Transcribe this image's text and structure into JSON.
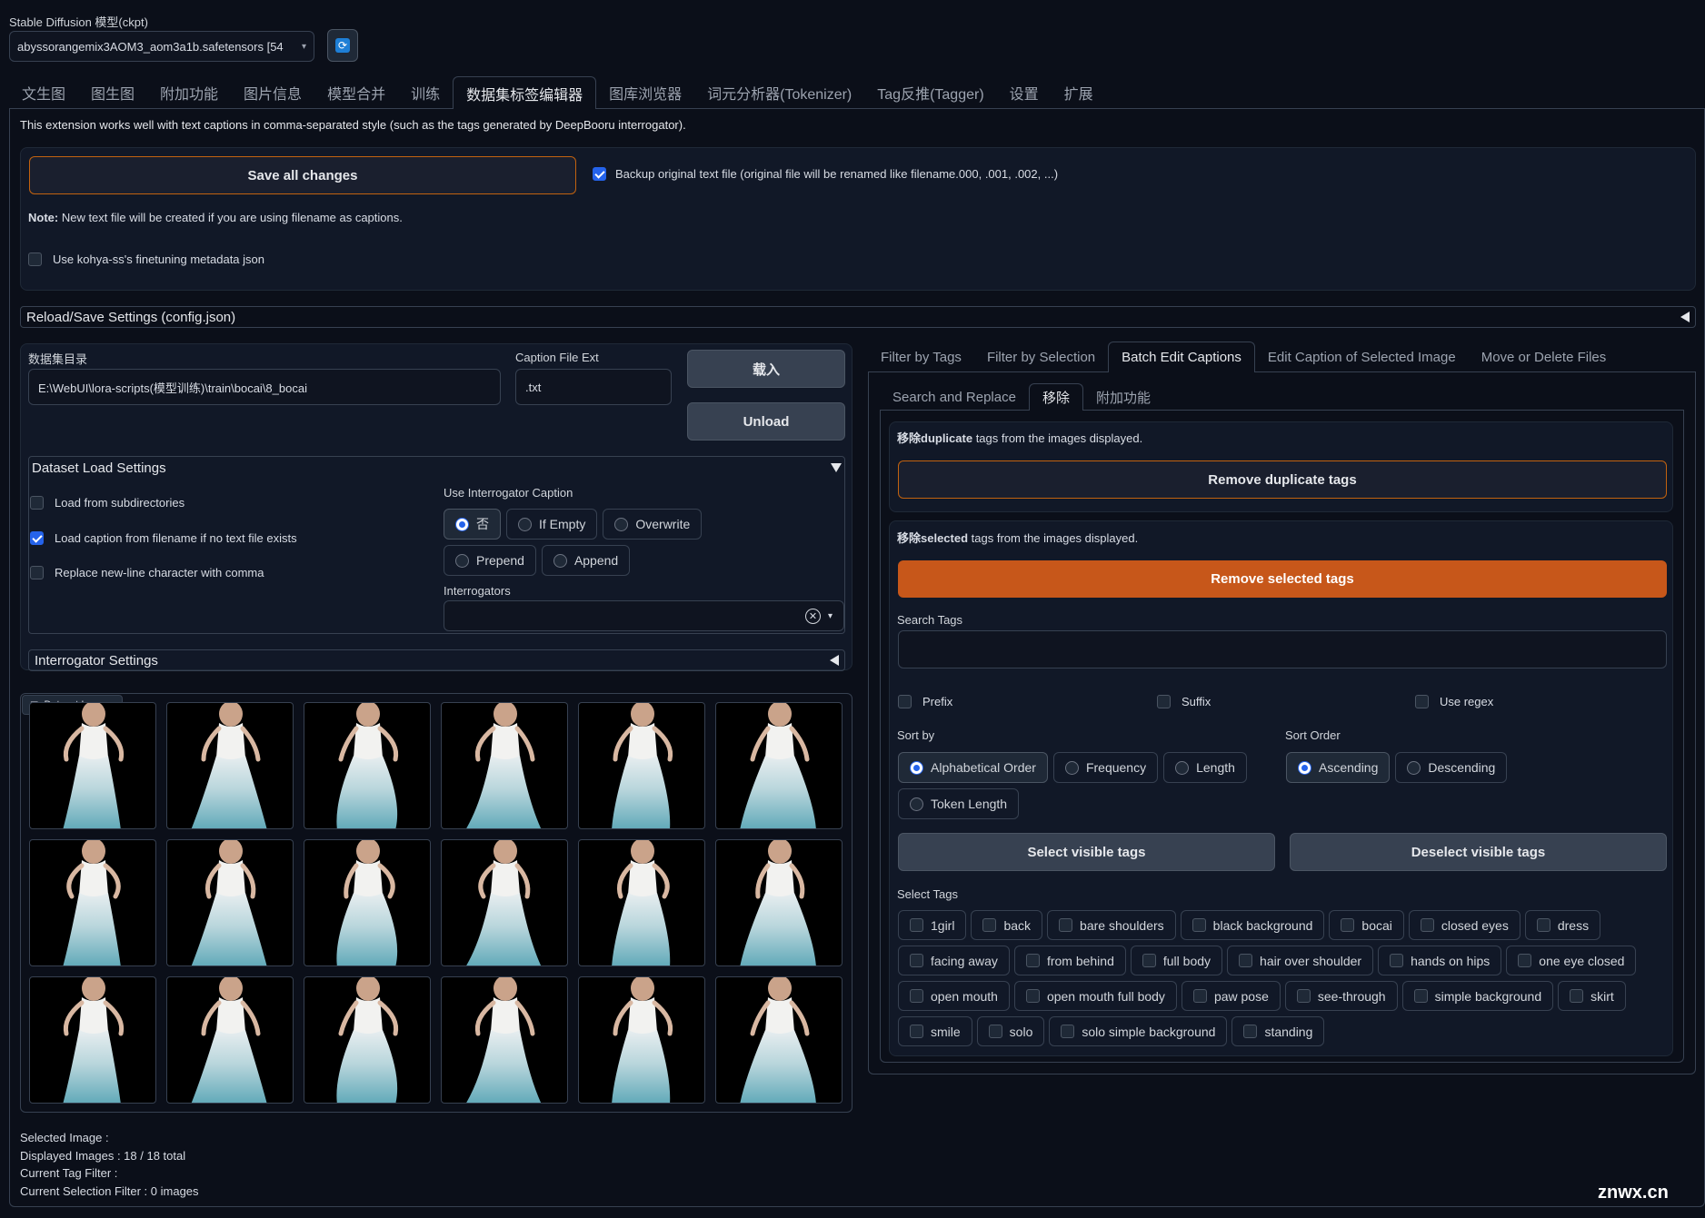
{
  "model": {
    "label": "Stable Diffusion 模型(ckpt)",
    "value": "abyssorangemix3AOM3_aom3a1b.safetensors [54"
  },
  "main_tabs": [
    {
      "label": "文生图"
    },
    {
      "label": "图生图"
    },
    {
      "label": "附加功能"
    },
    {
      "label": "图片信息"
    },
    {
      "label": "模型合并"
    },
    {
      "label": "训练"
    },
    {
      "label": "数据集标签编辑器"
    },
    {
      "label": "图库浏览器"
    },
    {
      "label": "词元分析器(Tokenizer)"
    },
    {
      "label": "Tag反推(Tagger)"
    },
    {
      "label": "设置"
    },
    {
      "label": "扩展"
    }
  ],
  "intro": "This extension works well with text captions in comma-separated style (such as the tags generated by DeepBooru interrogator).",
  "save_all": "Save all changes",
  "backup_label": "Backup original text file (original file will be renamed like filename.000, .001, .002, ...)",
  "note_bold": "Note:",
  "note_text": " New text file will be created if you are using filename as captions.",
  "kohya_label": "Use kohya-ss's finetuning metadata json",
  "reload_save": "Reload/Save Settings (config.json)",
  "dataset_dir": {
    "label": "数据集目录",
    "value": "E:\\WebUI\\lora-scripts(模型训练)\\train\\bocai\\8_bocai"
  },
  "caption_ext": {
    "label": "Caption File Ext",
    "value": ".txt"
  },
  "load_btn": "载入",
  "unload_btn": "Unload",
  "dataset_load_settings": {
    "title": "Dataset Load Settings",
    "load_subdirs": "Load from subdirectories",
    "load_caption_filename": "Load caption from filename if no text file exists",
    "replace_newline": "Replace new-line character with comma",
    "use_interrogator_label": "Use Interrogator Caption",
    "interrogator_options": [
      "否",
      "If Empty",
      "Overwrite",
      "Prepend",
      "Append"
    ],
    "interrogators_label": "Interrogators"
  },
  "interrogator_settings": "Interrogator Settings",
  "gallery_label": "Dataset Images",
  "status": {
    "selected": "Selected Image :",
    "displayed": "Displayed Images : 18 / 18 total",
    "tag_filter": "Current Tag Filter :",
    "selection_filter": "Current Selection Filter : 0 images"
  },
  "right_tabs": [
    {
      "label": "Filter by Tags"
    },
    {
      "label": "Filter by Selection"
    },
    {
      "label": "Batch Edit Captions"
    },
    {
      "label": "Edit Caption of Selected Image"
    },
    {
      "label": "Move or Delete Files"
    }
  ],
  "sub_tabs": [
    {
      "label": "Search and Replace"
    },
    {
      "label": "移除"
    },
    {
      "label": "附加功能"
    }
  ],
  "remove_dup": {
    "bold": "移除duplicate",
    "text": " tags from the images displayed.",
    "btn": "Remove duplicate tags"
  },
  "remove_sel": {
    "bold": "移除selected",
    "text": " tags from the images displayed.",
    "btn": "Remove selected tags"
  },
  "search_tags": "Search Tags",
  "prefix": "Prefix",
  "suffix": "Suffix",
  "use_regex": "Use regex",
  "sort_by": {
    "label": "Sort by",
    "options": [
      "Alphabetical Order",
      "Frequency",
      "Length",
      "Token Length"
    ]
  },
  "sort_order": {
    "label": "Sort Order",
    "options": [
      "Ascending",
      "Descending"
    ]
  },
  "select_visible": "Select visible tags",
  "deselect_visible": "Deselect visible tags",
  "select_tags_label": "Select Tags",
  "tags": [
    "1girl",
    "back",
    "bare shoulders",
    "black background",
    "bocai",
    "closed eyes",
    "dress",
    "facing away",
    "from behind",
    "full body",
    "hair over shoulder",
    "hands on hips",
    "one eye closed",
    "open mouth",
    "open mouth full body",
    "paw pose",
    "see-through",
    "simple background",
    "skirt",
    "smile",
    "solo",
    "solo simple background",
    "standing"
  ],
  "watermark": "znwx.cn",
  "colors": {
    "accent": "#c7571a",
    "blue": "#2563eb",
    "bg": "#0b0f19"
  }
}
